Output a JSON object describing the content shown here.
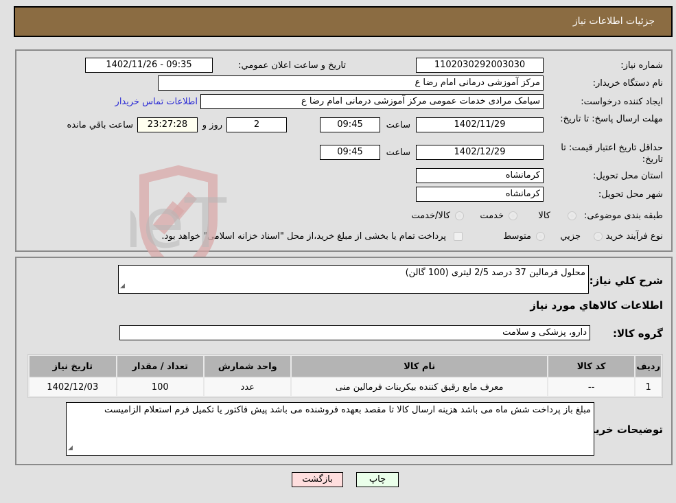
{
  "header": {
    "title": "جزئیات اطلاعات نیاز"
  },
  "details": {
    "need_number": {
      "label": "شماره نیاز:",
      "value": "1102030292003030"
    },
    "announce_datetime": {
      "label": "تاریخ و ساعت اعلان عمومي:",
      "value": "1402/11/26 - 09:35"
    },
    "buyer_org": {
      "label": "نام دستگاه خريدار:",
      "value": "مرکز آموزشی  درمانی امام رضا  ع"
    },
    "requester": {
      "label": "ايجاد کننده درخواست:",
      "value": "سیامک مرادی خدمات عمومی مرکز آموزشی  درمانی امام رضا  ع"
    },
    "buyer_contact_link": "اطلاعات تماس خريدار",
    "response_deadline": {
      "label": "مهلت ارسال پاسخ: تا تاریخ:",
      "date": "1402/11/29",
      "time_label": "ساعت",
      "time": "09:45",
      "days": "2",
      "days_label": "روز و",
      "remaining": "23:27:28",
      "remaining_label": "ساعت باقي مانده"
    },
    "price_validity": {
      "label": "حداقل تاريخ اعتبار قيمت: تا تاريخ:",
      "date": "1402/12/29",
      "time_label": "ساعت",
      "time": "09:45"
    },
    "delivery_province": {
      "label": "استان محل تحويل:",
      "value": "کرمانشاه"
    },
    "delivery_city": {
      "label": "شهر محل تحويل:",
      "value": "کرمانشاه"
    },
    "category": {
      "label": "طبقه بندی موضوعی:",
      "options": [
        "کالا",
        "خدمت",
        "کالا/خدمت"
      ]
    },
    "purchase_type": {
      "label": "نوع فرآيند خريد :",
      "options": [
        "جزيي",
        "متوسط"
      ],
      "note": "پرداخت تمام يا بخشی از مبلغ خريد،از محل \"اسناد خزانه اسلامی\" خواهد بود."
    }
  },
  "needs": {
    "summary_label": "شرح کلي نياز:",
    "summary_value": "محلول فرمالین 37 درصد 2/5 لیتری  (100 گالن)",
    "goods_info_title": "اطلاعات کالاهاي مورد نياز",
    "goods_group_label": "گروه کالا:",
    "goods_group_value": "دارو، پزشکی و سلامت",
    "table": {
      "headers": [
        "رديف",
        "کد کالا",
        "نام کالا",
        "واحد شمارش",
        "تعداد / مقدار",
        "تاريخ نياز"
      ],
      "rows": [
        [
          "1",
          "--",
          "معرف مایع رقیق کننده بیکربنات فرمالین منی",
          "عدد",
          "100",
          "1402/12/03"
        ]
      ]
    },
    "buyer_notes_label": "توضيحات خريدار:",
    "buyer_notes_value": "مبلغ باز پرداخت شش ماه می باشد هزینه ارسال کالا تا مقصد بعهده فروشنده می باشد پیش فاکتور یا تکمیل فرم استعلام الزامیست"
  },
  "buttons": {
    "print": "چاپ",
    "back": "بازگشت"
  },
  "watermark": {
    "text": "AriaTender.neT"
  },
  "colors": {
    "header_bg": "#8b6c42",
    "back_button_bg": "#ffdede",
    "print_button_bg": "#eaffea",
    "link": "#2b2bd4"
  }
}
